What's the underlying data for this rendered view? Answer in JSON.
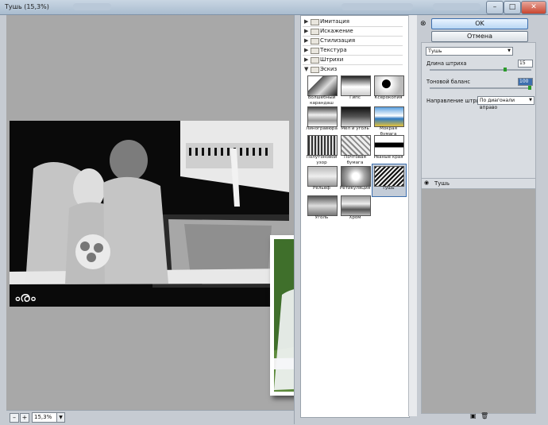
{
  "window": {
    "title": "Тушь (15,3%)"
  },
  "window_buttons": {
    "minimize": "–",
    "maximize": "□",
    "close": "✕"
  },
  "zoom": {
    "value": "15,3%",
    "minus": "–",
    "plus": "+"
  },
  "filter_categories": [
    {
      "label": "Имитация",
      "expanded": false
    },
    {
      "label": "Искажение",
      "expanded": false
    },
    {
      "label": "Стилизация",
      "expanded": false
    },
    {
      "label": "Текстура",
      "expanded": false
    },
    {
      "label": "Штрихи",
      "expanded": false
    },
    {
      "label": "Эскиз",
      "expanded": true
    }
  ],
  "sketch_filters": [
    {
      "label": "Волшебный карандаш"
    },
    {
      "label": "Гипс"
    },
    {
      "label": "Ксерокопия"
    },
    {
      "label": "Линогравюра"
    },
    {
      "label": "Мел и уголь"
    },
    {
      "label": "Мокрая бумага"
    },
    {
      "label": "Полутоновой узор"
    },
    {
      "label": "Почтовая бумага"
    },
    {
      "label": "Рваные края"
    },
    {
      "label": "Рельеф"
    },
    {
      "label": "Ретикуляция"
    },
    {
      "label": "Тушь",
      "selected": true
    },
    {
      "label": "Уголь"
    },
    {
      "label": "Хром"
    }
  ],
  "buttons": {
    "ok": "OK",
    "cancel": "Отмена"
  },
  "settings": {
    "filter_select": "Тушь",
    "stroke_length_label": "Длина штриха",
    "stroke_length_value": "15",
    "stroke_length_level": 0.75,
    "tonal_balance_label": "Тоновой баланс",
    "tonal_balance_value": "100",
    "tonal_balance_level": 1.0,
    "stroke_direction_label": "Направление штрихов:",
    "stroke_direction_value": "По диагонали вправо"
  },
  "layers": {
    "row_label": "Тушь"
  },
  "colors": {
    "accent": "#3d6fae",
    "knob": "#2b9b2b",
    "canvas": "#a8a8a8"
  }
}
